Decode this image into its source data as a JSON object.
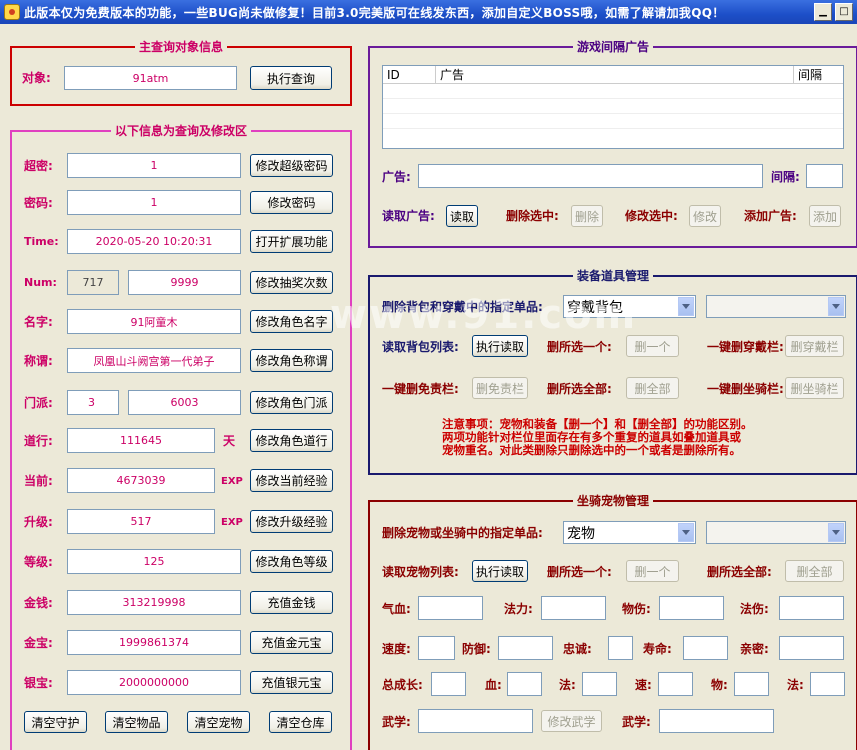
{
  "window": {
    "title": "此版本仅为免费版本的功能，一些BUG尚未做修复！目前3.0完美版可在线发东西，添加自定义BOSS哦，如需了解请加我QQ！",
    "minimize": "▁",
    "maximize": "□"
  },
  "query": {
    "title": "主查询对象信息",
    "target_label": "对象:",
    "target_value": "91atm",
    "button": "执行查询"
  },
  "edit": {
    "title": "以下信息为查询及修改区",
    "super_pwd": {
      "label": "超密:",
      "value": "1",
      "button": "修改超级密码"
    },
    "pwd": {
      "label": "密码:",
      "value": "1",
      "button": "修改密码"
    },
    "time": {
      "label": "Time:",
      "value": "2020-05-20 10:20:31",
      "button": "打开扩展功能"
    },
    "num": {
      "label": "Num:",
      "value1": "717",
      "value2": "9999",
      "button": "修改抽奖次数"
    },
    "name": {
      "label": "名字:",
      "value": "91阿童木",
      "button": "修改角色名字"
    },
    "title_f": {
      "label": "称谓:",
      "value": "凤凰山斗阙宫第一代弟子",
      "button": "修改角色称谓"
    },
    "sect": {
      "label": "门派:",
      "value1": "3",
      "value2": "6003",
      "button": "修改角色门派"
    },
    "dao": {
      "label": "道行:",
      "value": "111645",
      "unit": "天",
      "button": "修改角色道行"
    },
    "cur_exp": {
      "label": "当前:",
      "value": "4673039",
      "unit": "EXP",
      "button": "修改当前经验"
    },
    "up_exp": {
      "label": "升级:",
      "value": "517",
      "unit": "EXP",
      "button": "修改升级经验"
    },
    "level": {
      "label": "等级:",
      "value": "125",
      "button": "修改角色等级"
    },
    "money": {
      "label": "金钱:",
      "value": "313219998",
      "button": "充值金钱"
    },
    "gold": {
      "label": "金宝:",
      "value": "1999861374",
      "button": "充值金元宝"
    },
    "silver": {
      "label": "银宝:",
      "value": "2000000000",
      "button": "充值银元宝"
    },
    "clear_buttons": [
      "清空守护",
      "清空物品",
      "清空宠物",
      "清空仓库"
    ]
  },
  "ads": {
    "title": "游戏间隔广告",
    "columns": [
      "ID",
      "广告",
      "间隔"
    ],
    "ad_label": "广告:",
    "interval_label": "间隔:",
    "read_label": "读取广告:",
    "read_button": "读取",
    "delete_label": "删除选中:",
    "delete_button": "删除",
    "modify_label": "修改选中:",
    "modify_button": "修改",
    "add_label": "添加广告:",
    "add_button": "添加"
  },
  "equip": {
    "title": "装备道具管理",
    "delete_label": "删除背包和穿戴中的指定单品:",
    "select_value": "穿戴背包",
    "read_label": "读取背包列表:",
    "read_button": "执行读取",
    "del_one_label": "删所选一个:",
    "del_one_button": "删一个",
    "del_worn_label": "一键删穿戴栏:",
    "del_worn_button": "删穿戴栏",
    "del_free_label": "一键删免责栏:",
    "del_free_button": "删免责栏",
    "del_all_label": "删所选全部:",
    "del_all_button": "删全部",
    "del_mount_label": "一键删坐骑栏:",
    "del_mount_button": "删坐骑栏",
    "note": "注意事项：宠物和装备【删一个】和【删全部】的功能区别。\n两项功能针对栏位里面存在有多个重复的道具如叠加道具或\n宠物重名。对此类删除只删除选中的一个或者是删除所有。"
  },
  "pet": {
    "title": "坐骑宠物管理",
    "delete_label": "删除宠物或坐骑中的指定单品:",
    "select_value": "宠物",
    "read_label": "读取宠物列表:",
    "read_button": "执行读取",
    "del_one_label": "删所选一个:",
    "del_one_button": "删一个",
    "del_all_label": "删所选全部:",
    "del_all_button": "删全部",
    "hp": "气血:",
    "mana": "法力:",
    "phy_dmg": "物伤:",
    "mag_dmg": "法伤:",
    "speed": "速度:",
    "defense": "防御:",
    "loyalty": "忠诚:",
    "life": "寿命:",
    "intimacy": "亲密:",
    "growth": "总成长:",
    "g_hp": "血:",
    "g_mag": "法:",
    "g_spd": "速:",
    "g_phy": "物:",
    "g_mag2": "法:",
    "skill1": "武学:",
    "skill_button": "修改武学",
    "skill2": "武学:"
  },
  "watermark": "www.91.com",
  "colors": {
    "magenta": "#cc0066",
    "purple": "#4b0082",
    "navy": "#1a1a6e",
    "darkred": "#8b0000",
    "red": "#cc0000"
  }
}
